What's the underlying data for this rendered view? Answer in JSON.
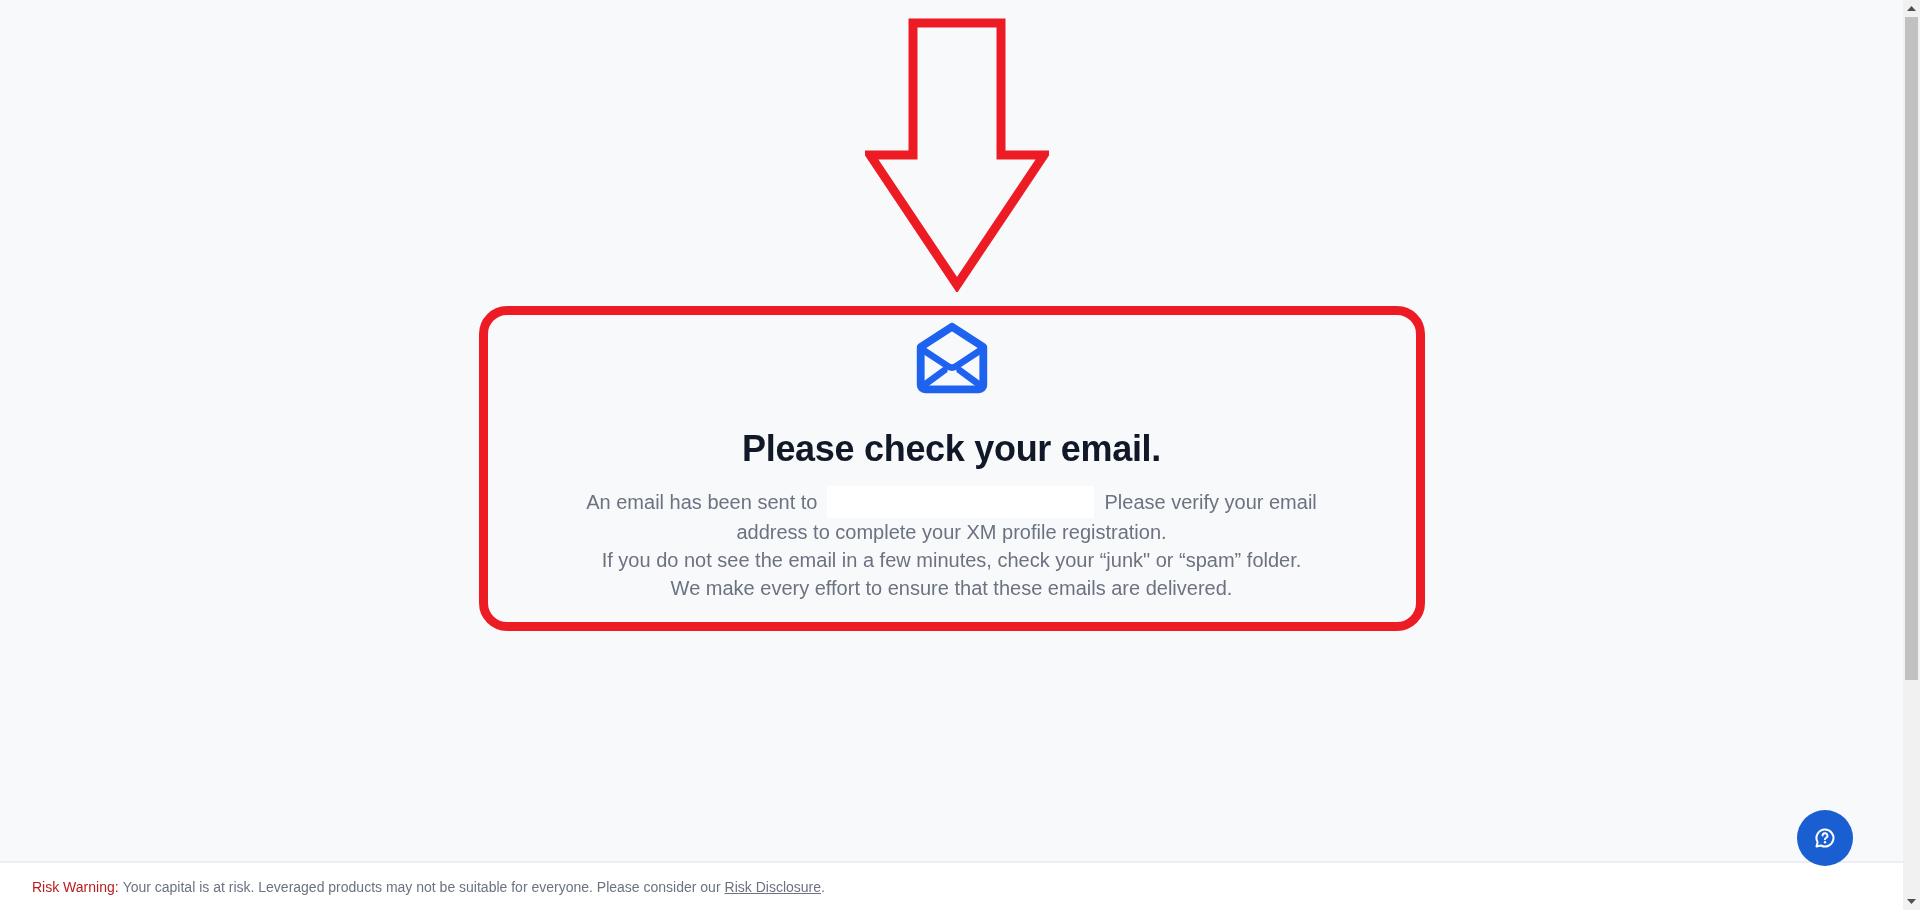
{
  "heading": "Please check your email.",
  "message": {
    "before": "An email has been sent to",
    "after": [
      "Please verify your email",
      "address to complete your XM profile registration."
    ]
  },
  "notes": [
    "If you do not see the email in a few minutes, check your “junk\" or “spam” folder.",
    "We make every effort to ensure that these emails are delivered."
  ],
  "footer": {
    "label": "Risk Warning:",
    "text": "Your capital is at risk. Leveraged products may not be suitable for everyone. Please consider our",
    "link": "Risk Disclosure",
    "end": "."
  }
}
